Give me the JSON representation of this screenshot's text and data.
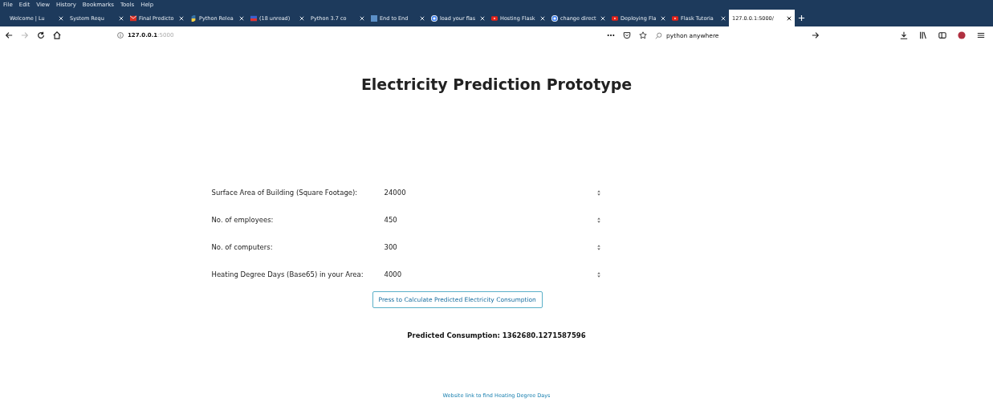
{
  "menu": [
    "File",
    "Edit",
    "View",
    "History",
    "Bookmarks",
    "Tools",
    "Help"
  ],
  "tabs": [
    {
      "title": "Welcome | Lu",
      "kind": "plain",
      "selected": false
    },
    {
      "title": "System Requ",
      "kind": "plain",
      "selected": false
    },
    {
      "title": "Final Predicto",
      "kind": "mail",
      "selected": false
    },
    {
      "title": "Python Relea",
      "kind": "python",
      "selected": false
    },
    {
      "title": "(18 unread)",
      "kind": "flag",
      "selected": false
    },
    {
      "title": "Python 3.7 co",
      "kind": "plain",
      "selected": false
    },
    {
      "title": "End to End",
      "kind": "square",
      "selected": false
    },
    {
      "title": "load your flas",
      "kind": "google",
      "selected": false
    },
    {
      "title": "Hosting Flask",
      "kind": "youtube",
      "selected": false
    },
    {
      "title": "change direct",
      "kind": "google",
      "selected": false
    },
    {
      "title": "Deploying Fla",
      "kind": "youtube",
      "selected": false
    },
    {
      "title": "Flask Tutoria",
      "kind": "youtube",
      "selected": false
    },
    {
      "title": "127.0.0.1:5000/",
      "kind": "plain",
      "selected": true
    }
  ],
  "address": {
    "host": "127.0.0.1",
    "port": ":5000"
  },
  "search": {
    "value": "python anywhere"
  },
  "page": {
    "title": "Electricity Prediction Prototype",
    "fields": [
      {
        "label": "Surface Area of Building (Square Footage):",
        "value": "24000"
      },
      {
        "label": "No. of employees:",
        "value": "450"
      },
      {
        "label": "No. of computers:",
        "value": "300"
      },
      {
        "label": "Heating Degree Days (Base65) in your Area:",
        "value": "4000"
      }
    ],
    "button": "Press to Calculate Predicted Electricity Consumption",
    "result": "Predicted Consumption: 1362680.1271587596",
    "link": "Website link to find Heating Degree Days"
  }
}
